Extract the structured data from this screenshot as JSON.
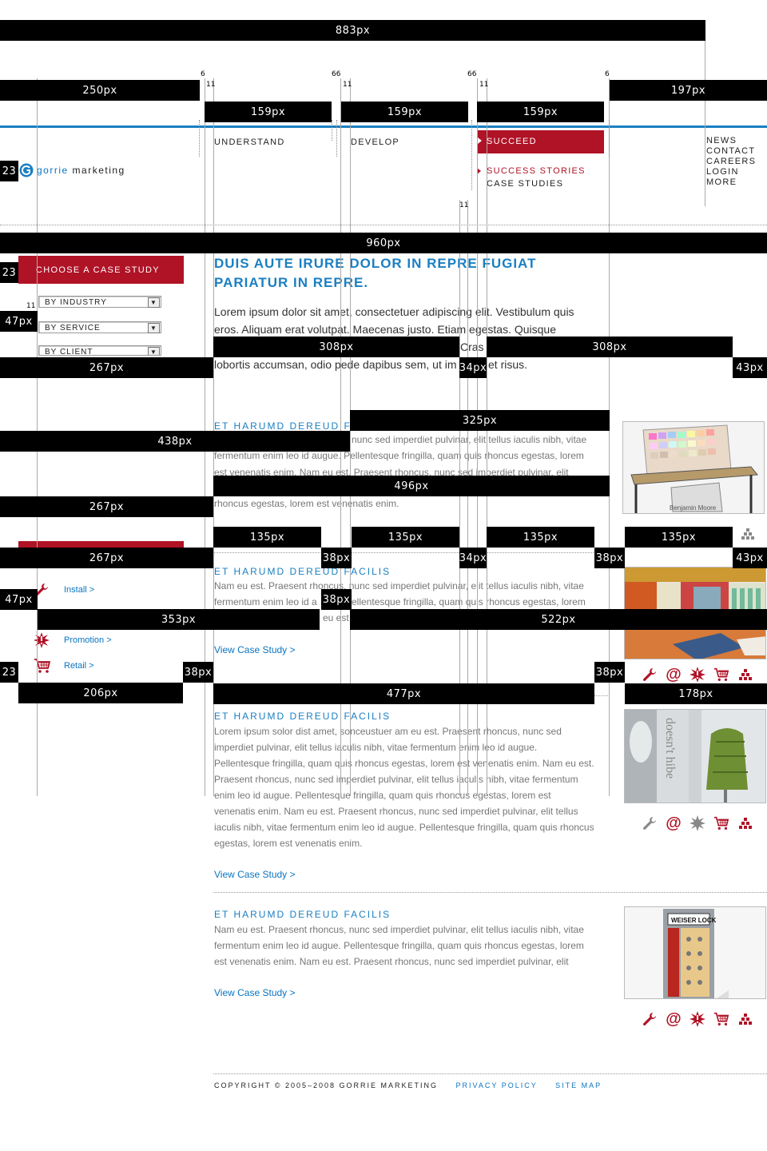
{
  "brand": {
    "name_part1": "gorrie",
    "name_part2": " marketing"
  },
  "nav": {
    "main": [
      {
        "label": "UNDERSTAND"
      },
      {
        "label": "DEVELOP"
      },
      {
        "label": "SUCCEED"
      }
    ],
    "sub": [
      {
        "label": "SUCCESS STORIES"
      },
      {
        "label": "CASE STUDIES"
      }
    ],
    "utility": [
      {
        "label": "NEWS"
      },
      {
        "label": "CONTACT"
      },
      {
        "label": "CAREERS"
      },
      {
        "label": "LOGIN"
      },
      {
        "label": "MORE"
      }
    ]
  },
  "sidebar": {
    "choose_title": "CHOOSE A CASE STUDY",
    "selects": [
      {
        "value": "BY INDUSTRY"
      },
      {
        "value": "BY SERVICE"
      },
      {
        "value": "BY CLIENT"
      }
    ],
    "services": [
      {
        "label": "Install >",
        "icon": "wrench-icon"
      },
      {
        "label": "Promotion >",
        "icon": "burst-icon"
      },
      {
        "label": "Retail >",
        "icon": "cart-icon"
      }
    ]
  },
  "hero": {
    "title": "DUIS AUTE IRURE DOLOR IN REPRE FUGIAT PARIATUR IN REPRE.",
    "line1": "Lorem ipsum dolor sit amet, consectetuer adipiscing elit. Vestibulum quis",
    "line2": "eros. Aliquam erat volutpat. Maecenas justo. Etiam egestas. Quisque",
    "line3_frag": "Cras i",
    "line4a": "lobortis accumsan, odio pede dapibus sem, ut im",
    "line4b": "et risus."
  },
  "cases": [
    {
      "heading_frag": "ET HARUMD DEREUD FA",
      "line1_frag": "nunc sed imperdiet pulvinar, elit tellus iaculis nibh, vitae",
      "line2": "fermentum enim leo id augue. Pellentesque fringilla, quam quis rhoncus egestas, lorem",
      "line3_frag": "est venenatis enim. Nam eu est. Praesent rhoncus, nunc sed imperdiet pulvinar, elit",
      "line4": "rhoncus egestas, lorem est venenatis enim."
    },
    {
      "heading": "ET HARUMD DEREUD FACILIS",
      "line1": "Nam eu est. Praesent rhoncus, nunc sed imperdiet pulvinar, elit tellus iaculis nibh, vitae",
      "line2a": "fermentum enim leo id a",
      "line2b": "ellentesque fringilla, quam quis rhoncus egestas, lorem",
      "line3_frag": "eu est",
      "link": "View Case Study >"
    },
    {
      "heading": "ET HARUMD DEREUD FACILIS",
      "body": "Lorem ipsum solor dist amet, sonceustuer am eu est. Praesent rhoncus, nunc sed imperdiet pulvinar, elit tellus iaculis nibh, vitae fermentum enim leo id augue. Pellentesque fringilla, quam quis rhoncus egestas, lorem est venenatis enim. Nam eu est. Praesent rhoncus, nunc sed imperdiet pulvinar, elit tellus iaculis nibh, vitae fermentum enim leo id augue. Pellentesque fringilla, quam quis rhoncus egestas, lorem est venenatis enim. Nam eu est. Praesent rhoncus, nunc sed imperdiet pulvinar, elit tellus iaculis nibh, vitae fermentum enim leo id augue. Pellentesque fringilla, quam quis rhoncus egestas, lorem est venenatis enim.",
      "link": "View Case Study >"
    },
    {
      "heading": "ET HARUMD DEREUD FACILIS",
      "body": "Nam eu est. Praesent rhoncus, nunc sed imperdiet pulvinar, elit tellus iaculis nibh, vitae fermentum enim leo id augue. Pellentesque fringilla, quam quis rhoncus egestas, lorem est venenatis enim. Nam eu est. Praesent rhoncus, nunc sed imperdiet pulvinar, elit",
      "link": "View Case Study >"
    }
  ],
  "images": [
    {
      "caption": "Benjamin Moore"
    },
    {
      "caption": "doesn't hibe"
    },
    {
      "caption": "WEISER LOCK"
    }
  ],
  "footer": {
    "copyright": "COPYRIGHT © 2005–2008 GORRIE MARKETING",
    "privacy": "PRIVACY POLICY",
    "sitemap": "SITE MAP"
  },
  "measures": {
    "w883": "883px",
    "w250": "250px",
    "w197": "197px",
    "w159": "159px",
    "w960": "960px",
    "w308": "308px",
    "w267": "267px",
    "w34": "34px",
    "w43": "43px",
    "w325": "325px",
    "w438": "438px",
    "w496": "496px",
    "w135": "135px",
    "w38": "38px",
    "w47": "47px",
    "w353": "353px",
    "w522": "522px",
    "w23": "23px",
    "w206": "206px",
    "w477": "477px",
    "w178": "178px",
    "n23": "23",
    "n6": "6",
    "n66": "66",
    "n11": "11"
  },
  "colors": {
    "accent_red": "#b01226",
    "accent_blue": "#0a74c0",
    "nav_rule": "#1a7fc1",
    "measure_bg": "#000000"
  }
}
